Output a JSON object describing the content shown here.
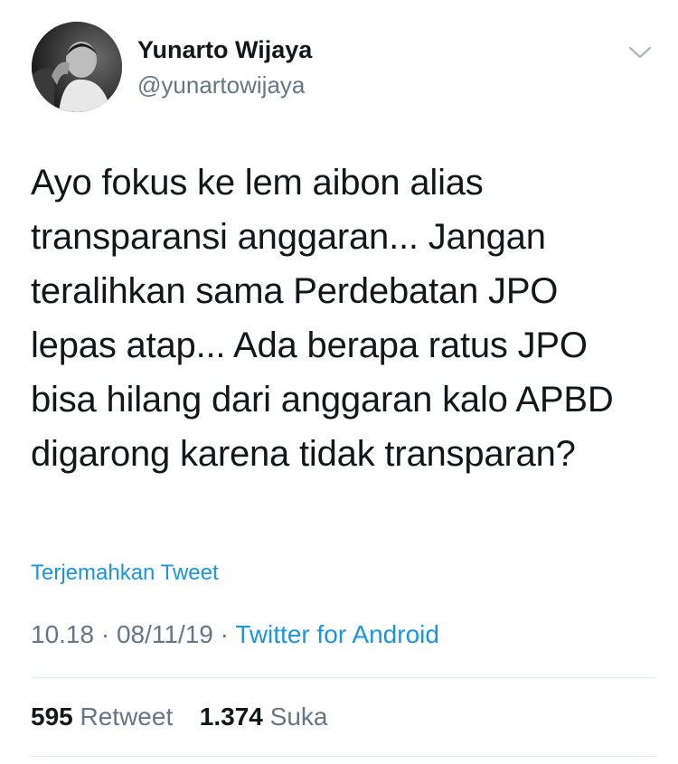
{
  "author": {
    "name": "Yunarto Wijaya",
    "handle": "@yunartowijaya"
  },
  "tweet": {
    "lines": [
      "Ayo fokus ke lem aibon alias",
      "transparansi anggaran... Jangan",
      "teralihkan sama Perdebatan JPO",
      "lepas atap... Ada berapa ratus JPO",
      "bisa hilang dari anggaran kalo APBD",
      "digarong karena tidak transparan?"
    ],
    "translate_label": "Terjemahkan Tweet",
    "time": "10.18",
    "separator": "·",
    "date": "08/11/19",
    "source": "Twitter for Android"
  },
  "stats": {
    "retweet_count": "595",
    "retweet_label": "Retweet",
    "like_count": "1.374",
    "like_label": "Suka"
  },
  "icons": {
    "menu": "chevron-down-icon"
  },
  "colors": {
    "link": "#1b95e0",
    "secondary_text": "#657786",
    "primary_text": "#14171a",
    "divider": "#e1e8ed"
  }
}
